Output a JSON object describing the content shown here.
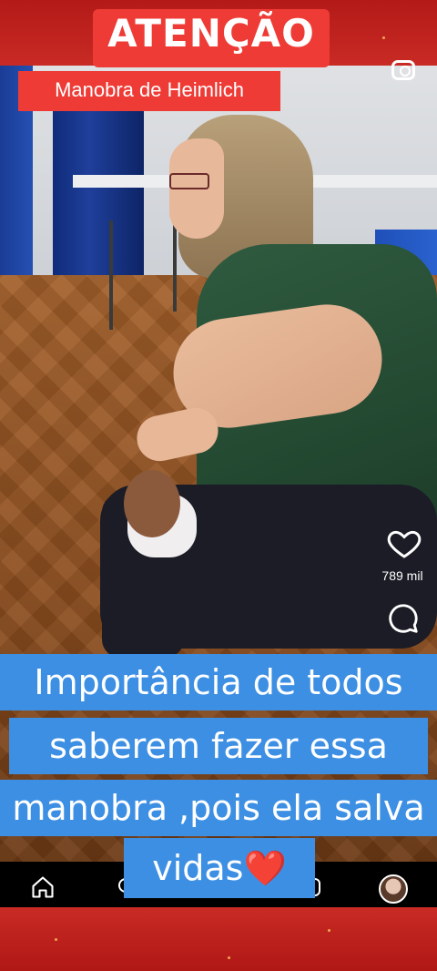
{
  "overlay": {
    "title": "ATENÇÃO",
    "subtitle": "Manobra de Heimlich"
  },
  "actions": {
    "likes_count": "789 mil",
    "like_icon": "heart-outline-icon",
    "comment_icon": "comment-bubble-icon",
    "camera_icon": "camera-icon"
  },
  "caption": {
    "line1": "Importância de todos",
    "line2": "saberem fazer essa",
    "line3": "manobra ,pois ela salva",
    "line4_text": "vidas",
    "line4_emoji": "❤️"
  },
  "navbar": {
    "items": [
      "home-icon",
      "search-icon",
      "reels-icon",
      "profile-avatar"
    ]
  },
  "colors": {
    "frame": "#c0201f",
    "banner": "#ee3b36",
    "caption_bg": "#3d8fe3",
    "navbar": "#000000"
  }
}
